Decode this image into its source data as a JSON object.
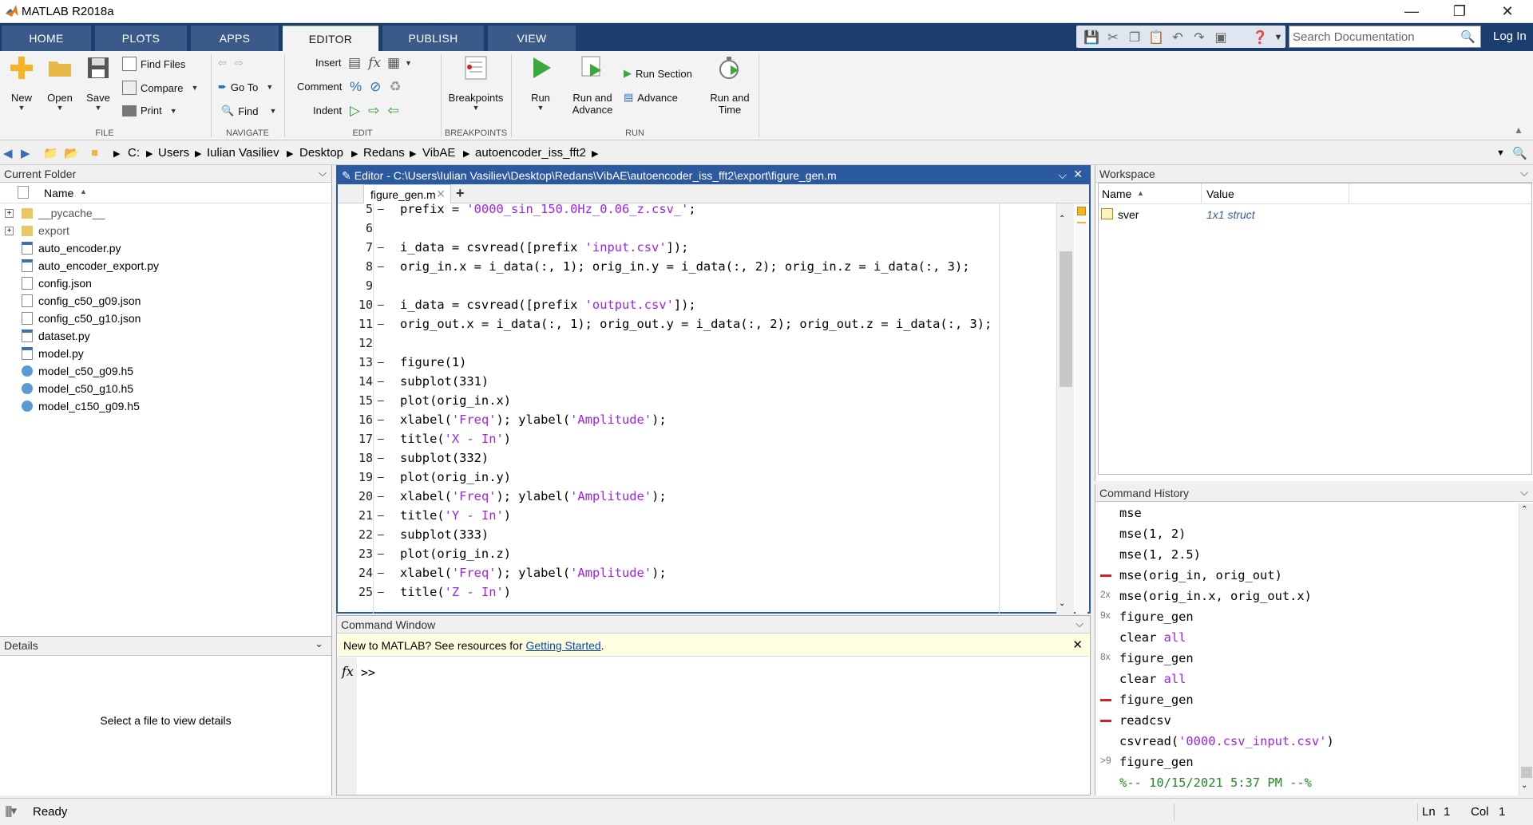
{
  "window": {
    "title": "MATLAB R2018a"
  },
  "tabs": [
    {
      "label": "HOME"
    },
    {
      "label": "PLOTS"
    },
    {
      "label": "APPS"
    },
    {
      "label": "EDITOR"
    },
    {
      "label": "PUBLISH"
    },
    {
      "label": "VIEW"
    }
  ],
  "search": {
    "placeholder": "Search Documentation"
  },
  "login": "Log In",
  "ribbon": {
    "file": {
      "new": "New",
      "open": "Open",
      "save": "Save",
      "find_files": "Find Files",
      "compare": "Compare",
      "print": "Print",
      "group": "FILE"
    },
    "navigate": {
      "goto": "Go To",
      "find": "Find",
      "group": "NAVIGATE"
    },
    "edit": {
      "insert": "Insert",
      "comment": "Comment",
      "indent": "Indent",
      "group": "EDIT"
    },
    "breakpoints": {
      "label": "Breakpoints",
      "group": "BREAKPOINTS"
    },
    "run": {
      "run": "Run",
      "run_advance_1": "Run and",
      "run_advance_2": "Advance",
      "run_section": "Run Section",
      "advance": "Advance",
      "run_time_1": "Run and",
      "run_time_2": "Time",
      "group": "RUN"
    }
  },
  "path": [
    "C:",
    "Users",
    "Iulian Vasiliev",
    "Desktop",
    "Redans",
    "VibAE",
    "autoencoder_iss_fft2"
  ],
  "current_folder": {
    "title": "Current Folder",
    "column": "Name",
    "items": [
      {
        "name": "__pycache__",
        "type": "folder"
      },
      {
        "name": "export",
        "type": "folder"
      },
      {
        "name": "auto_encoder.py",
        "type": "py"
      },
      {
        "name": "auto_encoder_export.py",
        "type": "py"
      },
      {
        "name": "config.json",
        "type": "file"
      },
      {
        "name": "config_c50_g09.json",
        "type": "file"
      },
      {
        "name": "config_c50_g10.json",
        "type": "file"
      },
      {
        "name": "dataset.py",
        "type": "py"
      },
      {
        "name": "model.py",
        "type": "py"
      },
      {
        "name": "model_c50_g09.h5",
        "type": "h5"
      },
      {
        "name": "model_c50_g10.h5",
        "type": "h5"
      },
      {
        "name": "model_c150_g09.h5",
        "type": "h5"
      }
    ]
  },
  "details": {
    "title": "Details",
    "empty": "Select a file to view details"
  },
  "editor": {
    "title": "Editor - C:\\Users\\Iulian Vasiliev\\Desktop\\Redans\\VibAE\\autoencoder_iss_fft2\\export\\figure_gen.m",
    "tab": "figure_gen.m",
    "lines": [
      {
        "n": "5",
        "dash": "–",
        "parts": [
          {
            "t": "prefix = "
          },
          {
            "s": "'0000_sin_150.0Hz_0.06_z.csv_'"
          },
          {
            "t": ";"
          }
        ]
      },
      {
        "n": "6",
        "dash": "",
        "parts": []
      },
      {
        "n": "7",
        "dash": "–",
        "parts": [
          {
            "t": "i_data = csvread([prefix "
          },
          {
            "s": "'input.csv'"
          },
          {
            "t": "]);"
          }
        ]
      },
      {
        "n": "8",
        "dash": "–",
        "parts": [
          {
            "t": "orig_in.x = i_data(:, 1); orig_in.y = i_data(:, 2); orig_in.z = i_data(:, 3);"
          }
        ]
      },
      {
        "n": "9",
        "dash": "",
        "parts": []
      },
      {
        "n": "10",
        "dash": "–",
        "parts": [
          {
            "t": "i_data = csvread([prefix "
          },
          {
            "s": "'output.csv'"
          },
          {
            "t": "]);"
          }
        ]
      },
      {
        "n": "11",
        "dash": "–",
        "parts": [
          {
            "t": "orig_out.x = i_data(:, 1); orig_out.y = i_data(:, 2); orig_out.z = i_data(:, 3);"
          }
        ]
      },
      {
        "n": "12",
        "dash": "",
        "parts": []
      },
      {
        "n": "13",
        "dash": "–",
        "parts": [
          {
            "t": "figure(1)"
          }
        ]
      },
      {
        "n": "14",
        "dash": "–",
        "parts": [
          {
            "t": "subplot(331)"
          }
        ]
      },
      {
        "n": "15",
        "dash": "–",
        "parts": [
          {
            "t": "plot(orig_in.x)"
          }
        ]
      },
      {
        "n": "16",
        "dash": "–",
        "parts": [
          {
            "t": "xlabel("
          },
          {
            "s": "'Freq'"
          },
          {
            "t": "); ylabel("
          },
          {
            "s": "'Amplitude'"
          },
          {
            "t": ");"
          }
        ]
      },
      {
        "n": "17",
        "dash": "–",
        "parts": [
          {
            "t": "title("
          },
          {
            "s": "'X - In'"
          },
          {
            "t": ")"
          }
        ]
      },
      {
        "n": "18",
        "dash": "–",
        "parts": [
          {
            "t": "subplot(332)"
          }
        ]
      },
      {
        "n": "19",
        "dash": "–",
        "parts": [
          {
            "t": "plot(orig_in.y)"
          }
        ]
      },
      {
        "n": "20",
        "dash": "–",
        "parts": [
          {
            "t": "xlabel("
          },
          {
            "s": "'Freq'"
          },
          {
            "t": "); ylabel("
          },
          {
            "s": "'Amplitude'"
          },
          {
            "t": ");"
          }
        ]
      },
      {
        "n": "21",
        "dash": "–",
        "parts": [
          {
            "t": "title("
          },
          {
            "s": "'Y - In'"
          },
          {
            "t": ")"
          }
        ]
      },
      {
        "n": "22",
        "dash": "–",
        "parts": [
          {
            "t": "subplot(333)"
          }
        ]
      },
      {
        "n": "23",
        "dash": "–",
        "parts": [
          {
            "t": "plot(orig_in.z)"
          }
        ]
      },
      {
        "n": "24",
        "dash": "–",
        "parts": [
          {
            "t": "xlabel("
          },
          {
            "s": "'Freq'"
          },
          {
            "t": "); ylabel("
          },
          {
            "s": "'Amplitude'"
          },
          {
            "t": ");"
          }
        ]
      },
      {
        "n": "25",
        "dash": "–",
        "parts": [
          {
            "t": "title("
          },
          {
            "s": "'Z - In'"
          },
          {
            "t": ")"
          }
        ]
      }
    ]
  },
  "command_window": {
    "title": "Command Window",
    "banner_text": "New to MATLAB? See resources for ",
    "banner_link": "Getting Started",
    "banner_end": ".",
    "prompt": ">>"
  },
  "workspace": {
    "title": "Workspace",
    "col_name": "Name",
    "col_value": "Value",
    "vars": [
      {
        "name": "sver",
        "value": "1x1 struct"
      }
    ]
  },
  "history": {
    "title": "Command History",
    "items": [
      {
        "mark": "",
        "parts": [
          {
            "t": "mse"
          }
        ]
      },
      {
        "mark": "",
        "parts": [
          {
            "t": "mse(1, 2)"
          }
        ]
      },
      {
        "mark": "",
        "parts": [
          {
            "t": "mse(1, 2.5)"
          }
        ]
      },
      {
        "mark": "red",
        "parts": [
          {
            "t": "mse(orig_in, orig_out)"
          }
        ]
      },
      {
        "mark": "2x",
        "parts": [
          {
            "t": "mse(orig_in.x, orig_out.x)"
          }
        ]
      },
      {
        "mark": "9x",
        "parts": [
          {
            "t": "figure_gen"
          }
        ]
      },
      {
        "mark": "",
        "parts": [
          {
            "t": "clear "
          },
          {
            "s": "all"
          }
        ]
      },
      {
        "mark": "8x",
        "parts": [
          {
            "t": "figure_gen"
          }
        ]
      },
      {
        "mark": "",
        "parts": [
          {
            "t": "clear "
          },
          {
            "s": "all"
          }
        ]
      },
      {
        "mark": "red",
        "parts": [
          {
            "t": "figure_gen"
          }
        ]
      },
      {
        "mark": "red",
        "parts": [
          {
            "t": "readcsv"
          }
        ]
      },
      {
        "mark": "",
        "parts": [
          {
            "t": "csvread("
          },
          {
            "s": "'0000.csv_input.csv'"
          },
          {
            "t": ")"
          }
        ]
      },
      {
        "mark": ">9",
        "parts": [
          {
            "t": "figure_gen"
          }
        ]
      },
      {
        "mark": "",
        "parts": [
          {
            "c": "%-- 10/15/2021 5:37 PM --%"
          }
        ]
      }
    ]
  },
  "status": {
    "text": "Ready",
    "ln_label": "Ln",
    "ln": "1",
    "col_label": "Col",
    "col": "1"
  },
  "colors": {
    "accent": "#1b3e6e",
    "editor_border": "#2c5aa0",
    "string": "#a020f0",
    "comment": "#228b22"
  }
}
